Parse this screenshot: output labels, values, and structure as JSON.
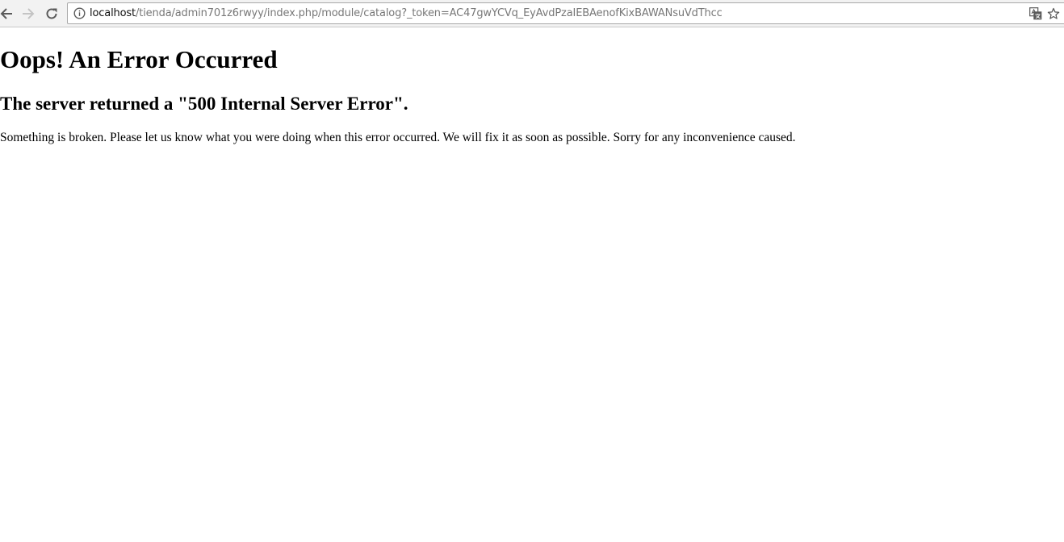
{
  "browser": {
    "url_host": "localhost",
    "url_path": "/tienda/admin701z6rwyy/index.php/module/catalog?_token=AC47gwYCVq_EyAvdPzaIEBAenofKixBAWANsuVdThcc",
    "icons": {
      "back": "back-arrow-icon",
      "forward": "forward-arrow-icon",
      "reload": "reload-icon",
      "site_info": "info-icon",
      "translate": "translate-icon",
      "bookmark": "star-icon"
    }
  },
  "page": {
    "title": "Oops! An Error Occurred",
    "subtitle": "The server returned a \"500 Internal Server Error\".",
    "message": "Something is broken. Please let us know what you were doing when this error occurred. We will fix it as soon as possible. Sorry for any inconvenience caused."
  }
}
